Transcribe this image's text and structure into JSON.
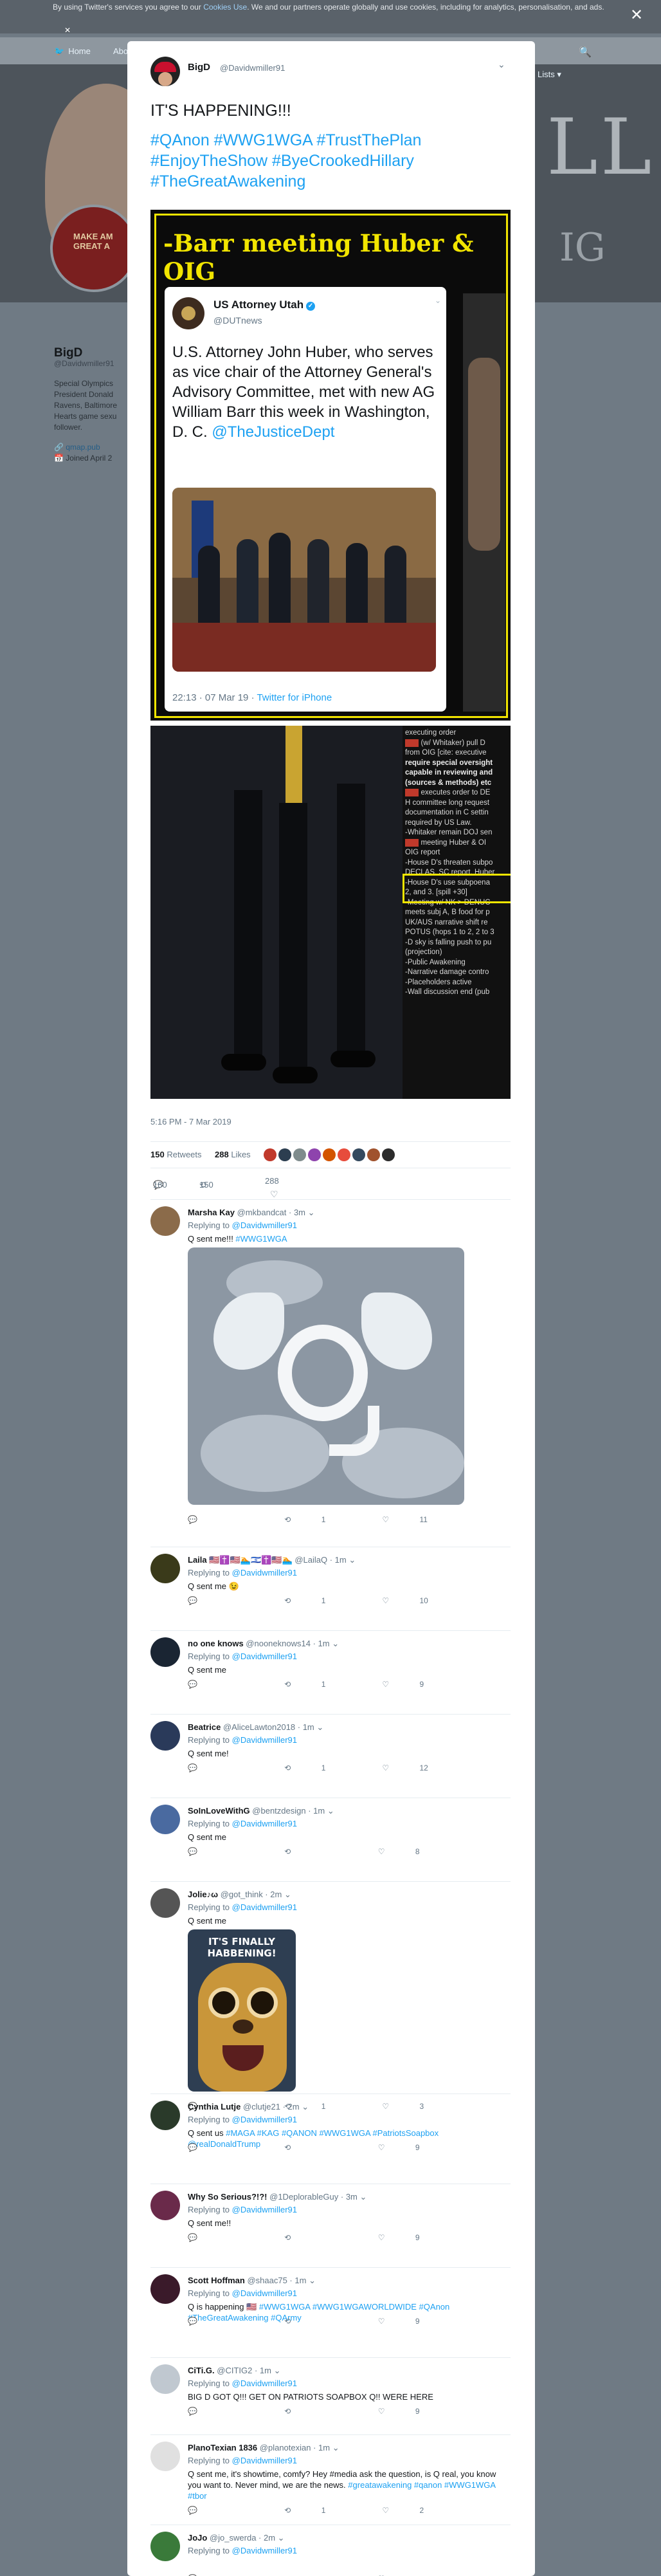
{
  "cookie": {
    "text": "By using Twitter's services you agree to our",
    "link": "Cookies Use",
    "rest": ". We and our partners operate globally and use cookies, including for analytics, personalisation, and ads.",
    "close": "✕",
    "close2": "✕"
  },
  "nav": {
    "home": "Home",
    "about": "Abo",
    "rightnav": "Lists ▾"
  },
  "profile": {
    "name": "BigD",
    "handle": "@Davidwmiller91",
    "bio": "Special Olympics President Donald Ravens, Baltimore Hearts game sexu follower.",
    "link": "🔗 qmap.pub",
    "joined": "📅 Joined April 2",
    "hat_text": "MAKE AM GREAT A"
  },
  "tweet": {
    "display_name": "BigD",
    "handle": "@Davidwmiller91",
    "text": "IT'S HAPPENING!!!",
    "hashtags": "#QAnon #WWG1WGA #TrustThePlan #EnjoyTheShow #ByeCrookedHillary #TheGreatAwakening",
    "image_title": "-Barr meeting Huber & OIG",
    "embedded": {
      "name": "US Attorney Utah",
      "verified": "✓",
      "handle": "@DUTnews",
      "text": "U.S. Attorney John Huber, who serves as vice chair of the Attorney General's Advisory Committee, met with new AG William Barr this week in Washington, D. C.",
      "mention": "@TheJusticeDept",
      "time": "22:13 · 07 Mar 19 · ",
      "source": "Twitter for iPhone"
    },
    "list_lines": [
      "executing order",
      "[red] (w/ Whitaker) pull D",
      "from OIG [cite: executive",
      "require special oversight",
      "capable in reviewing and",
      "(sources & methods) etc",
      "[red] executes order to DE",
      "H committee long request",
      "documentation in C settin",
      "required by US Law.",
      "-Whitaker remain DOJ sen",
      "[red] meeting Huber & OI",
      "OIG report",
      "-House D's threaten subpo",
      "DECLAS, SC report, Huber",
      "-House D's use subpoena",
      "2, and 3. [spill +30]",
      "-Meeting w/ NK > DENUC",
      "meets subj A, B food for p",
      "UK/AUS narrative shift re",
      "POTUS (hops 1 to 2, 2 to 3",
      "-D sky is falling push to pu",
      "(projection)",
      "-Public Awakening",
      "-Narrative damage contro",
      "-Placeholders active",
      "-Wall discussion end (pub"
    ],
    "timestamp": "5:16 PM - 7 Mar 2019",
    "retweets": "150",
    "retweets_label": "Retweets",
    "likes": "288",
    "likes_label": "Likes",
    "reply_count": "180",
    "rt_count": "150",
    "like_count": "288"
  },
  "replies": [
    {
      "name": "Marsha Kay",
      "handle": "@mkbandcat · 3m",
      "to": "@Davidwmiller91",
      "text": "Q sent me!!!",
      "tag": " #WWG1WGA",
      "counts": [
        "",
        "1",
        "11"
      ]
    },
    {
      "name": "Laila 🇺🇸✝️🇺🇸🏊🇮🇱✝️🇺🇸🏊",
      "handle": "@LailaQ · 1m",
      "to": "@Davidwmiller91",
      "text": "Q sent me 😉",
      "tag": "",
      "counts": [
        "",
        "1",
        "10"
      ]
    },
    {
      "name": "no one knows",
      "handle": "@nooneknows14 · 1m",
      "to": "@Davidwmiller91",
      "text": "Q sent me",
      "tag": "",
      "counts": [
        "",
        "1",
        "9"
      ]
    },
    {
      "name": "Beatrice",
      "handle": "@AliceLawton2018 · 1m",
      "to": "@Davidwmiller91",
      "text": "Q sent me!",
      "tag": "",
      "counts": [
        "",
        "1",
        "12"
      ]
    },
    {
      "name": "SoInLoveWithG",
      "handle": "@bentzdesign · 1m",
      "to": "@Davidwmiller91",
      "text": "Q sent me",
      "tag": "",
      "counts": [
        "",
        "",
        "8"
      ]
    },
    {
      "name": "Jolie♪ω",
      "handle": "@got_think · 2m",
      "to": "@Davidwmiller91",
      "text": "Q sent me",
      "tag": "",
      "counts": [
        "",
        "1",
        "3"
      ]
    },
    {
      "name": "Cynthia Lutje",
      "handle": "@clutje21 · 2m",
      "to": "@Davidwmiller91",
      "text": "Q sent us ",
      "tag": "#MAGA #KAG #QANON #WWG1WGA #PatriotsSoapbox @realDonaldTrump",
      "counts": [
        "",
        "",
        "9"
      ]
    },
    {
      "name": "Why So Serious?!?!",
      "handle": "@1DeplorableGuy · 3m",
      "to": "@Davidwmiller91",
      "text": "Q sent me!!",
      "tag": "",
      "counts": [
        "",
        "",
        "9"
      ]
    },
    {
      "name": "Scott Hoffman",
      "handle": "@shaac75 · 1m",
      "to": "@Davidwmiller91",
      "text": "Q is happening 🇺🇸 ",
      "tag": "#WWG1WGA #WWG1WGAWORLDWIDE #QAnon #TheGreatAwakening #QArmy",
      "counts": [
        "",
        "",
        "9"
      ]
    },
    {
      "name": "CiTi.G.",
      "handle": "@CITIG2 · 1m",
      "to": "@Davidwmiller91",
      "text": "BIG D GOT Q!!! GET ON PATRIOTS SOAPBOX Q!! WERE HERE",
      "tag": "",
      "counts": [
        "",
        "",
        "9"
      ]
    },
    {
      "name": "PlanoTexian 1836",
      "handle": "@planotexian · 1m",
      "to": "@Davidwmiller91",
      "text": "Q sent me, it's showtime, comfy? Hey #media ask the question, is Q real, you know you want to. Never mind, we are the news. ",
      "tag": "#greatawakening #qanon #WWG1WGA #tbor",
      "counts": [
        "",
        "1",
        "2"
      ]
    },
    {
      "name": "JoJo",
      "handle": "@jo_swerda · 2m",
      "to": "@Davidwmiller91",
      "text": "",
      "tag": "",
      "counts": [
        "",
        "",
        ""
      ]
    }
  ],
  "icons": {
    "reply": "💬",
    "retweet": "⟲",
    "like": "♡",
    "chevron": "⌄"
  },
  "colors": {
    "accent": "#1da1f2",
    "yellow": "#f2e500",
    "red": "#c0392b"
  }
}
